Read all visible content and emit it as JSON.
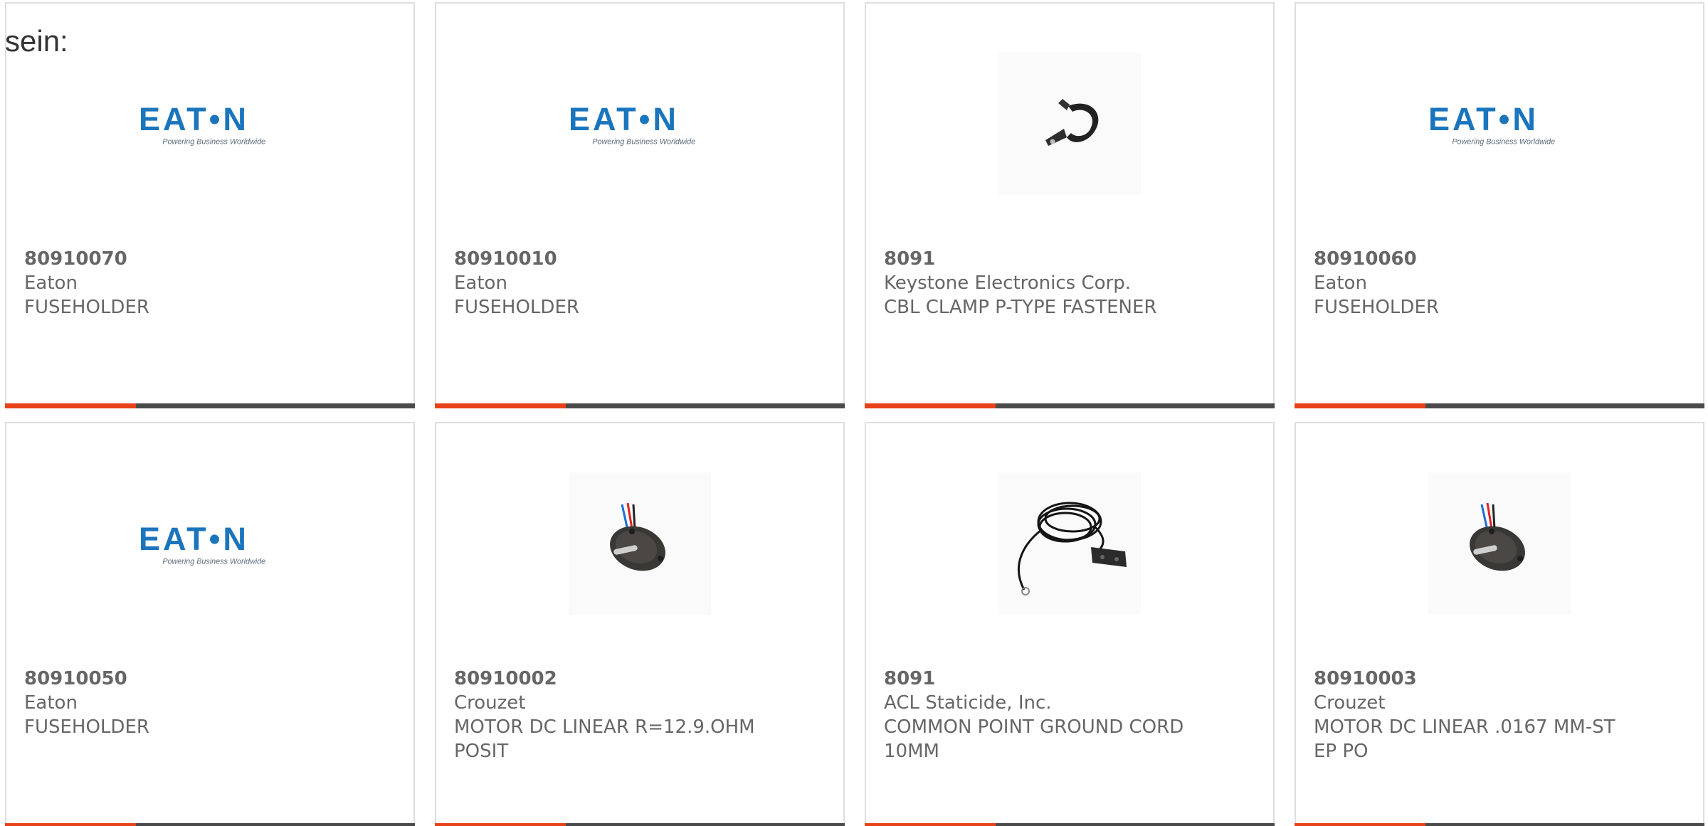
{
  "lead_text": "sein:",
  "colors": {
    "accent_bar": "#e8421a",
    "dark_bar": "#4a4a4a",
    "eaton_blue": "#1b75bc",
    "text": "#666666",
    "card_border": "#dedede"
  },
  "products": [
    {
      "part_number": "80910070",
      "manufacturer": "Eaton",
      "description": "FUSEHOLDER",
      "image": "eaton-logo",
      "logo_tagline": "Powering Business Worldwide"
    },
    {
      "part_number": "80910010",
      "manufacturer": "Eaton",
      "description": "FUSEHOLDER",
      "image": "eaton-logo",
      "logo_tagline": "Powering Business Worldwide"
    },
    {
      "part_number": "8091",
      "manufacturer": "Keystone Electronics Corp.",
      "description": "CBL CLAMP P-TYPE FASTENER",
      "image": "cable-clamp-photo"
    },
    {
      "part_number": "80910060",
      "manufacturer": "Eaton",
      "description": "FUSEHOLDER",
      "image": "eaton-logo",
      "logo_tagline": "Powering Business Worldwide"
    },
    {
      "part_number": "80910050",
      "manufacturer": "Eaton",
      "description": "FUSEHOLDER",
      "image": "eaton-logo",
      "logo_tagline": "Powering Business Worldwide"
    },
    {
      "part_number": "80910002",
      "manufacturer": "Crouzet",
      "description": "MOTOR DC LINEAR R=12.9.OHM POSIT",
      "image": "linear-motor-photo"
    },
    {
      "part_number": "8091",
      "manufacturer": "ACL Staticide, Inc.",
      "description": "COMMON POINT GROUND CORD 10MM",
      "image": "ground-cord-photo"
    },
    {
      "part_number": "80910003",
      "manufacturer": "Crouzet",
      "description": "MOTOR DC LINEAR .0167 MM-STEP PO",
      "image": "linear-motor-photo"
    }
  ]
}
